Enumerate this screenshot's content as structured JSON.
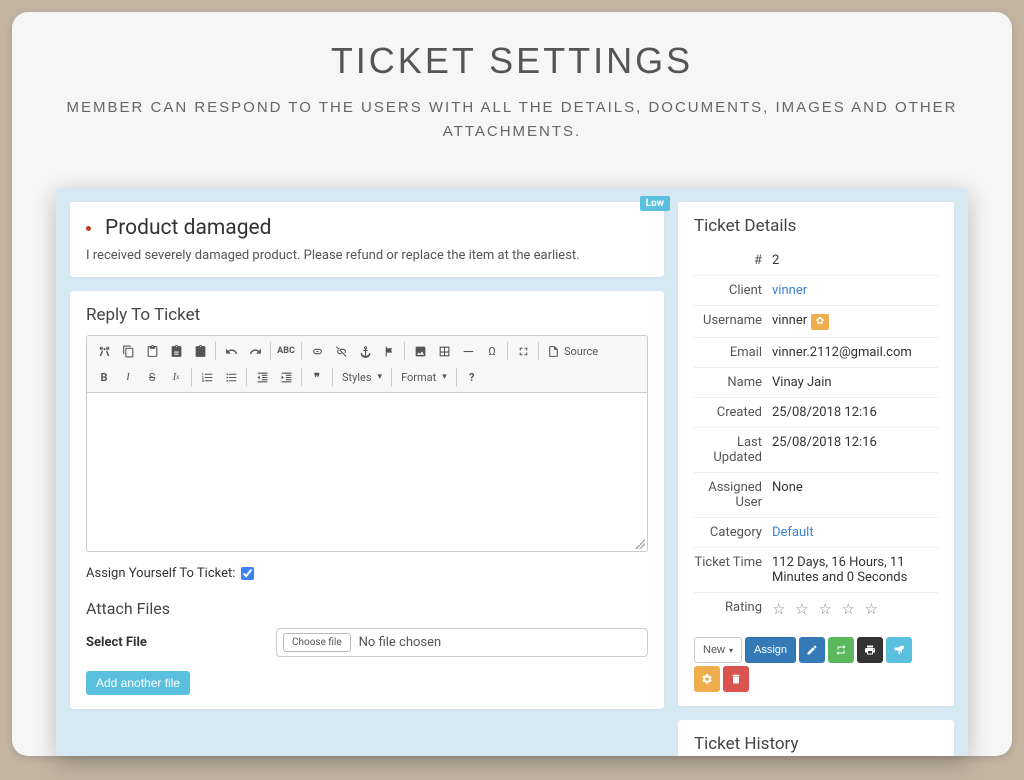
{
  "page": {
    "title": "TICKET SETTINGS",
    "subtitle": "MEMBER CAN RESPOND TO THE USERS WITH ALL THE DETAILS, DOCUMENTS, IMAGES AND OTHER ATTACHMENTS."
  },
  "ticket": {
    "priority": "Low",
    "title": "Product damaged",
    "description": "I received severely damaged product. Please refund or replace the item at the earliest."
  },
  "reply": {
    "heading": "Reply To Ticket",
    "toolbar": {
      "styles": "Styles",
      "format": "Format",
      "source": "Source"
    },
    "assign_label": "Assign Yourself To Ticket:",
    "assign_checked": true
  },
  "attach": {
    "heading": "Attach Files",
    "select_label": "Select File",
    "choose_button": "Choose file",
    "no_file": "No file chosen",
    "add_button": "Add another file"
  },
  "details": {
    "heading": "Ticket Details",
    "rows": [
      {
        "key": "#",
        "val": "2"
      },
      {
        "key": "Client",
        "val": "vinner",
        "link": true
      },
      {
        "key": "Username",
        "val": "vinner",
        "gear": true
      },
      {
        "key": "Email",
        "val": "vinner.2112@gmail.com"
      },
      {
        "key": "Name",
        "val": "Vinay Jain"
      },
      {
        "key": "Created",
        "val": "25/08/2018 12:16"
      },
      {
        "key": "Last Updated",
        "val": "25/08/2018 12:16"
      },
      {
        "key": "Assigned User",
        "val": "None"
      },
      {
        "key": "Category",
        "val": "Default",
        "link": true
      },
      {
        "key": "Ticket Time",
        "val": "112 Days, 16 Hours, 11 Minutes and 0 Seconds"
      },
      {
        "key": "Rating",
        "val": "stars"
      }
    ],
    "rating_stars": "☆ ☆ ☆ ☆ ☆"
  },
  "actions": {
    "new": "New",
    "assign": "Assign"
  },
  "history": {
    "heading": "Ticket History"
  }
}
